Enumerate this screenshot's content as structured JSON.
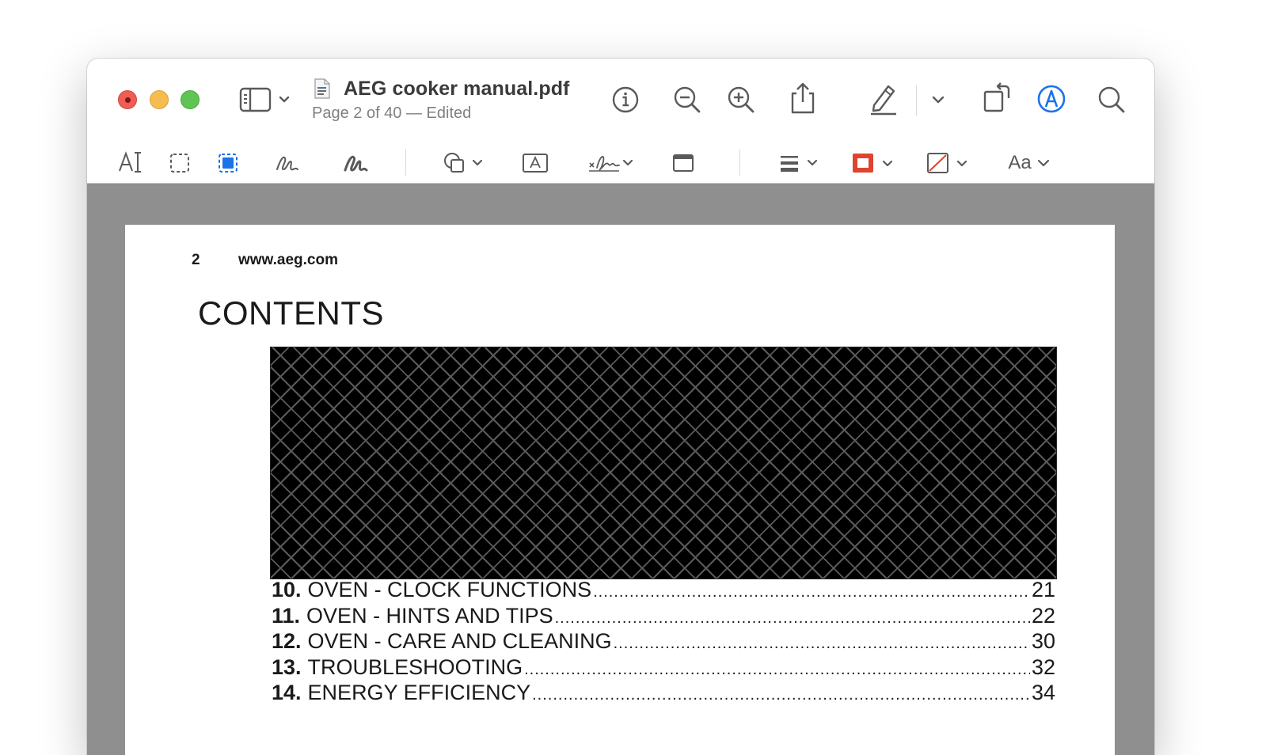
{
  "window": {
    "doc_title": "AEG cooker manual.pdf",
    "doc_subtitle": "Page 2 of 40 — Edited"
  },
  "toolbar": {
    "icons": [
      "sidebar-icon",
      "info-icon",
      "zoom-out-icon",
      "zoom-in-icon",
      "share-icon",
      "highlight-pen-icon",
      "rotate-icon",
      "markup-icon",
      "search-icon"
    ]
  },
  "markup_toolbar": {
    "text_style_label": "Aa",
    "border_color": "#e0432f",
    "accent_color": "#1a73e8",
    "icons": [
      "text-selection-icon",
      "rect-selection-icon",
      "redact-selection-icon",
      "sketch-icon",
      "draw-icon",
      "shapes-icon",
      "text-box-icon",
      "sign-icon",
      "note-icon",
      "line-style-icon",
      "border-color-icon",
      "fill-color-icon",
      "text-style-icon"
    ]
  },
  "page": {
    "number": "2",
    "url": "www.aeg.com",
    "heading": "CONTENTS",
    "toc": [
      {
        "num": "10.",
        "title": "OVEN - CLOCK FUNCTIONS",
        "page": "21"
      },
      {
        "num": "11.",
        "title": "OVEN - HINTS AND TIPS",
        "page": "22"
      },
      {
        "num": "12.",
        "title": "OVEN - CARE AND CLEANING",
        "page": "30"
      },
      {
        "num": "13.",
        "title": "TROUBLESHOOTING",
        "page": "32"
      },
      {
        "num": "14.",
        "title": "ENERGY EFFICIENCY",
        "page": "34"
      }
    ]
  }
}
